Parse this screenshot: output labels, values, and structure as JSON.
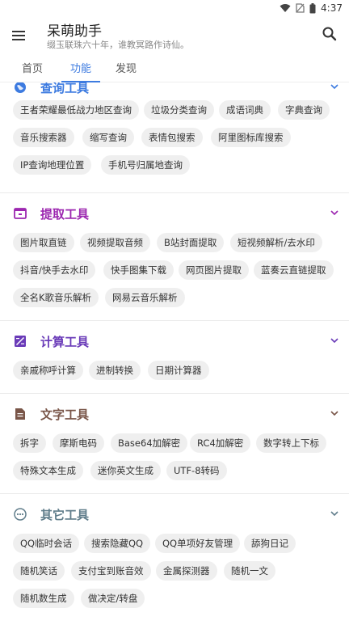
{
  "status": {
    "time": "4:37"
  },
  "app": {
    "title": "呆萌助手",
    "subtitle": "缀玉联珠六十年，谁教冥路作诗仙。"
  },
  "tabs": [
    "首页",
    "功能",
    "发现"
  ],
  "sections": [
    {
      "title": "查询工具",
      "color": "#3d7be0",
      "icon": "globe-icon",
      "items": [
        "王者荣耀最低战力地区查询",
        "垃圾分类查询",
        "成语词典",
        "字典查询",
        "音乐搜索器",
        "缩写查询",
        "表情包搜索",
        "阿里图标库搜索",
        "IP查询地理位置",
        "手机号归属地查询"
      ]
    },
    {
      "title": "提取工具",
      "color": "#9c27b0",
      "icon": "archive-icon",
      "items": [
        "图片取直链",
        "视频提取音频",
        "B站封面提取",
        "短视频解析/去水印",
        "抖音/快手去水印",
        "快手图集下载",
        "网页图片提取",
        "蓝奏云直链提取",
        "全名K歌音乐解析",
        "网易云音乐解析"
      ]
    },
    {
      "title": "计算工具",
      "color": "#6a3bb8",
      "icon": "calculator-icon",
      "items": [
        "亲戚称呼计算",
        "进制转换",
        "日期计算器"
      ]
    },
    {
      "title": "文字工具",
      "color": "#795548",
      "icon": "document-icon",
      "items": [
        "拆字",
        "摩斯电码",
        "Base64加解密",
        "RC4加解密",
        "数字转上下标",
        "特殊文本生成",
        "迷你英文生成",
        "UTF-8转码"
      ]
    },
    {
      "title": "其它工具",
      "color": "#607d8b",
      "icon": "more-icon",
      "items": [
        "QQ临时会话",
        "搜索隐藏QQ",
        "QQ单项好友管理",
        "舔狗日记",
        "随机笑话",
        "支付宝到账音效",
        "金属探测器",
        "随机一文",
        "随机数生成",
        "做决定/转盘"
      ]
    }
  ],
  "colors": {
    "accent": "#3d7be0",
    "chip_bg": "#efefef"
  }
}
